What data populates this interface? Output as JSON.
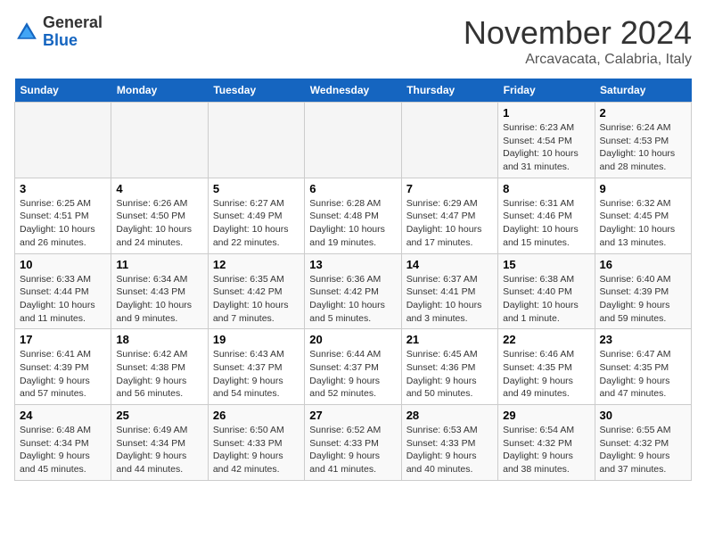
{
  "header": {
    "logo_line1": "General",
    "logo_line2": "Blue",
    "month": "November 2024",
    "location": "Arcavacata, Calabria, Italy"
  },
  "calendar": {
    "days_of_week": [
      "Sunday",
      "Monday",
      "Tuesday",
      "Wednesday",
      "Thursday",
      "Friday",
      "Saturday"
    ],
    "weeks": [
      [
        {
          "day": "",
          "info": ""
        },
        {
          "day": "",
          "info": ""
        },
        {
          "day": "",
          "info": ""
        },
        {
          "day": "",
          "info": ""
        },
        {
          "day": "",
          "info": ""
        },
        {
          "day": "1",
          "info": "Sunrise: 6:23 AM\nSunset: 4:54 PM\nDaylight: 10 hours and 31 minutes."
        },
        {
          "day": "2",
          "info": "Sunrise: 6:24 AM\nSunset: 4:53 PM\nDaylight: 10 hours and 28 minutes."
        }
      ],
      [
        {
          "day": "3",
          "info": "Sunrise: 6:25 AM\nSunset: 4:51 PM\nDaylight: 10 hours and 26 minutes."
        },
        {
          "day": "4",
          "info": "Sunrise: 6:26 AM\nSunset: 4:50 PM\nDaylight: 10 hours and 24 minutes."
        },
        {
          "day": "5",
          "info": "Sunrise: 6:27 AM\nSunset: 4:49 PM\nDaylight: 10 hours and 22 minutes."
        },
        {
          "day": "6",
          "info": "Sunrise: 6:28 AM\nSunset: 4:48 PM\nDaylight: 10 hours and 19 minutes."
        },
        {
          "day": "7",
          "info": "Sunrise: 6:29 AM\nSunset: 4:47 PM\nDaylight: 10 hours and 17 minutes."
        },
        {
          "day": "8",
          "info": "Sunrise: 6:31 AM\nSunset: 4:46 PM\nDaylight: 10 hours and 15 minutes."
        },
        {
          "day": "9",
          "info": "Sunrise: 6:32 AM\nSunset: 4:45 PM\nDaylight: 10 hours and 13 minutes."
        }
      ],
      [
        {
          "day": "10",
          "info": "Sunrise: 6:33 AM\nSunset: 4:44 PM\nDaylight: 10 hours and 11 minutes."
        },
        {
          "day": "11",
          "info": "Sunrise: 6:34 AM\nSunset: 4:43 PM\nDaylight: 10 hours and 9 minutes."
        },
        {
          "day": "12",
          "info": "Sunrise: 6:35 AM\nSunset: 4:42 PM\nDaylight: 10 hours and 7 minutes."
        },
        {
          "day": "13",
          "info": "Sunrise: 6:36 AM\nSunset: 4:42 PM\nDaylight: 10 hours and 5 minutes."
        },
        {
          "day": "14",
          "info": "Sunrise: 6:37 AM\nSunset: 4:41 PM\nDaylight: 10 hours and 3 minutes."
        },
        {
          "day": "15",
          "info": "Sunrise: 6:38 AM\nSunset: 4:40 PM\nDaylight: 10 hours and 1 minute."
        },
        {
          "day": "16",
          "info": "Sunrise: 6:40 AM\nSunset: 4:39 PM\nDaylight: 9 hours and 59 minutes."
        }
      ],
      [
        {
          "day": "17",
          "info": "Sunrise: 6:41 AM\nSunset: 4:39 PM\nDaylight: 9 hours and 57 minutes."
        },
        {
          "day": "18",
          "info": "Sunrise: 6:42 AM\nSunset: 4:38 PM\nDaylight: 9 hours and 56 minutes."
        },
        {
          "day": "19",
          "info": "Sunrise: 6:43 AM\nSunset: 4:37 PM\nDaylight: 9 hours and 54 minutes."
        },
        {
          "day": "20",
          "info": "Sunrise: 6:44 AM\nSunset: 4:37 PM\nDaylight: 9 hours and 52 minutes."
        },
        {
          "day": "21",
          "info": "Sunrise: 6:45 AM\nSunset: 4:36 PM\nDaylight: 9 hours and 50 minutes."
        },
        {
          "day": "22",
          "info": "Sunrise: 6:46 AM\nSunset: 4:35 PM\nDaylight: 9 hours and 49 minutes."
        },
        {
          "day": "23",
          "info": "Sunrise: 6:47 AM\nSunset: 4:35 PM\nDaylight: 9 hours and 47 minutes."
        }
      ],
      [
        {
          "day": "24",
          "info": "Sunrise: 6:48 AM\nSunset: 4:34 PM\nDaylight: 9 hours and 45 minutes."
        },
        {
          "day": "25",
          "info": "Sunrise: 6:49 AM\nSunset: 4:34 PM\nDaylight: 9 hours and 44 minutes."
        },
        {
          "day": "26",
          "info": "Sunrise: 6:50 AM\nSunset: 4:33 PM\nDaylight: 9 hours and 42 minutes."
        },
        {
          "day": "27",
          "info": "Sunrise: 6:52 AM\nSunset: 4:33 PM\nDaylight: 9 hours and 41 minutes."
        },
        {
          "day": "28",
          "info": "Sunrise: 6:53 AM\nSunset: 4:33 PM\nDaylight: 9 hours and 40 minutes."
        },
        {
          "day": "29",
          "info": "Sunrise: 6:54 AM\nSunset: 4:32 PM\nDaylight: 9 hours and 38 minutes."
        },
        {
          "day": "30",
          "info": "Sunrise: 6:55 AM\nSunset: 4:32 PM\nDaylight: 9 hours and 37 minutes."
        }
      ]
    ]
  }
}
